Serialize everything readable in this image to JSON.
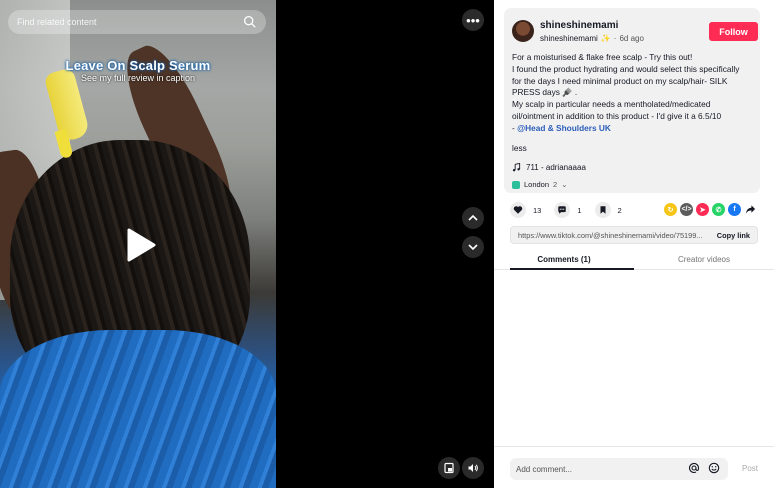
{
  "search": {
    "placeholder": "Find related content"
  },
  "video": {
    "overlay_title": "Leave On Scalp Serum",
    "overlay_subtitle": "See my full review in caption"
  },
  "more_label": "•••",
  "post": {
    "username": "shineshinemami",
    "handle": "shineshinemami",
    "handle_emoji": "✨",
    "separator": "·",
    "date": "6d ago",
    "follow_label": "Follow",
    "description_lines": [
      "For a moisturised & flake free scalp - Try this out!",
      "I found the product hydrating and would select this specifically",
      "for the days I need minimal product on my scalp/hair- SILK",
      "PRESS days 🪮 .",
      "My scalp in particular needs a mentholated/medicated",
      "oil/ointment in addition to this product - I'd give it a 6.5/10"
    ],
    "mention_prefix": "- ",
    "mention": "@Head & Shoulders UK",
    "less_label": "less",
    "music": "711 - adrianaaaa",
    "location": "London",
    "location_count": "2",
    "location_caret": "⌄"
  },
  "stats": {
    "likes": "13",
    "comments": "1",
    "saves": "2"
  },
  "share_colors": [
    "#f5c518",
    "#5c5c5c",
    "#fe2c55",
    "#25d366",
    "#1877f2"
  ],
  "link": {
    "url": "https://www.tiktok.com/@shineshinemami/video/75199...",
    "copy_label": "Copy link"
  },
  "tabs": [
    {
      "label": "Comments (1)"
    },
    {
      "label": "Creator videos"
    }
  ],
  "comment": {
    "placeholder": "Add comment...",
    "post_label": "Post"
  }
}
